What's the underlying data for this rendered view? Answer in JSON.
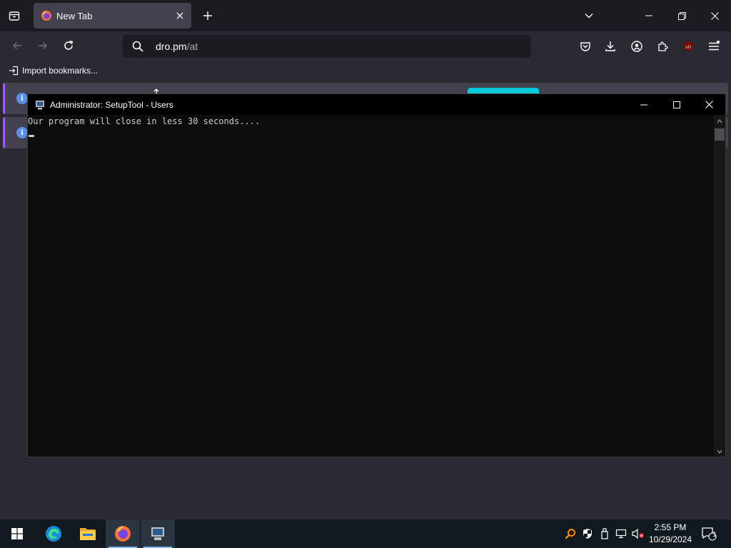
{
  "browser": {
    "tab": {
      "title": "New Tab"
    },
    "url": {
      "host": "dro.pm",
      "path": "/at"
    },
    "bookmarks": {
      "import_label": "Import bookmarks..."
    }
  },
  "console": {
    "title": "Administrator:  SetupTool - Users",
    "output": "Our program will close in less 30 seconds...."
  },
  "taskbar": {
    "clock_time": "2:55 PM",
    "clock_date": "10/29/2024",
    "notification_count": "1",
    "apps": [
      "Microsoft Edge",
      "File Explorer",
      "Firefox",
      "SetupTool"
    ]
  },
  "colors": {
    "firefox_dark": "#1c1b22",
    "firefox_toolbar": "#2b2a33",
    "console_bg": "#0c0c0c",
    "taskbar_bg": "#101820",
    "accent_cyan": "#00c8d7"
  }
}
